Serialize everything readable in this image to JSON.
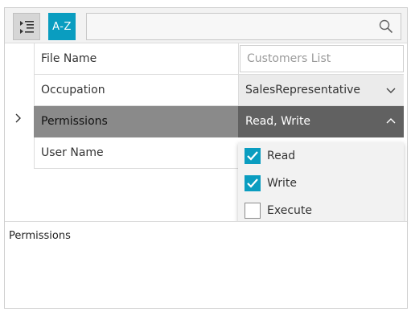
{
  "toolbar": {
    "categorize_icon": "categorized-list-icon",
    "sort_label": "A-Z",
    "search": {
      "value": "",
      "icon": "search-icon"
    }
  },
  "rows": [
    {
      "label": "File Name",
      "value": "Customers List",
      "editor": "text",
      "placeholder": true
    },
    {
      "label": "Occupation",
      "value": "SalesRepresentative",
      "editor": "combo",
      "expanded": false
    },
    {
      "label": "Permissions",
      "value": "Read, Write",
      "editor": "checked-combo",
      "expanded": true,
      "selected": true
    },
    {
      "label": "User Name",
      "value": "",
      "editor": "text"
    }
  ],
  "permissions_dropdown": {
    "options": [
      {
        "label": "Read",
        "checked": true
      },
      {
        "label": "Write",
        "checked": true
      },
      {
        "label": "Execute",
        "checked": false
      }
    ]
  },
  "description": {
    "title": "Permissions"
  },
  "colors": {
    "accent": "#0a9dc0",
    "selected_label_bg": "#8a8a8a",
    "selected_value_bg": "#616161",
    "toolbar_bg": "#f2f2f2"
  }
}
